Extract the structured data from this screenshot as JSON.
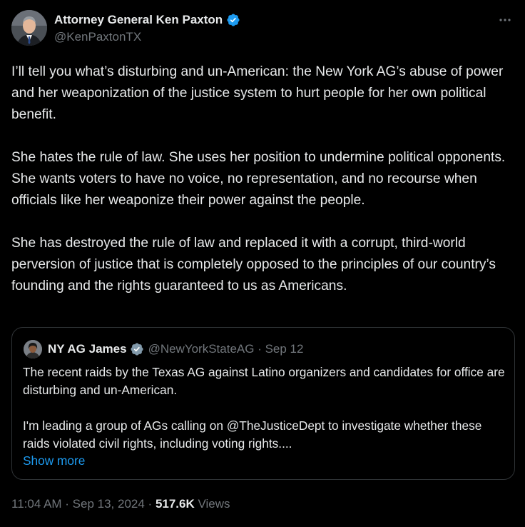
{
  "author": {
    "name": "Attorney General Ken Paxton",
    "handle": "@KenPaxtonTX",
    "verified_icon": "verified-badge-icon"
  },
  "menu_icon": "more-options-icon",
  "tweet": {
    "paragraphs": [
      "I’ll tell you what’s disturbing and un-American: the New York AG’s abuse of power and her weaponization of the justice system to hurt people for her own political benefit.",
      "She hates the rule of law. She uses her position to undermine political opponents. She wants voters to have no voice, no representation, and no recourse when officials like her weaponize their power against the people.",
      "She has destroyed the rule of law and replaced it with a corrupt, third-world perversion of justice that is completely opposed to the principles of our country’s founding and the rights guaranteed to us as Americans."
    ]
  },
  "quoted": {
    "name": "NY AG James",
    "handle_date": "@NewYorkStateAG · Sep 12",
    "paragraphs": [
      "The recent raids by the Texas AG against Latino organizers and candidates for office are disturbing and un-American.",
      "I'm leading a group of AGs calling on @TheJusticeDept to investigate whether these raids violated civil rights, including voting rights...."
    ],
    "show_more": "Show more"
  },
  "meta": {
    "time_date": "11:04 AM · Sep 13, 2024 · ",
    "views_count": "517.6K",
    "views_label": " Views"
  },
  "colors": {
    "background": "#000000",
    "text": "#e7e9ea",
    "secondary": "#71767b",
    "accent": "#1d9bf0",
    "border": "#2f3336"
  }
}
